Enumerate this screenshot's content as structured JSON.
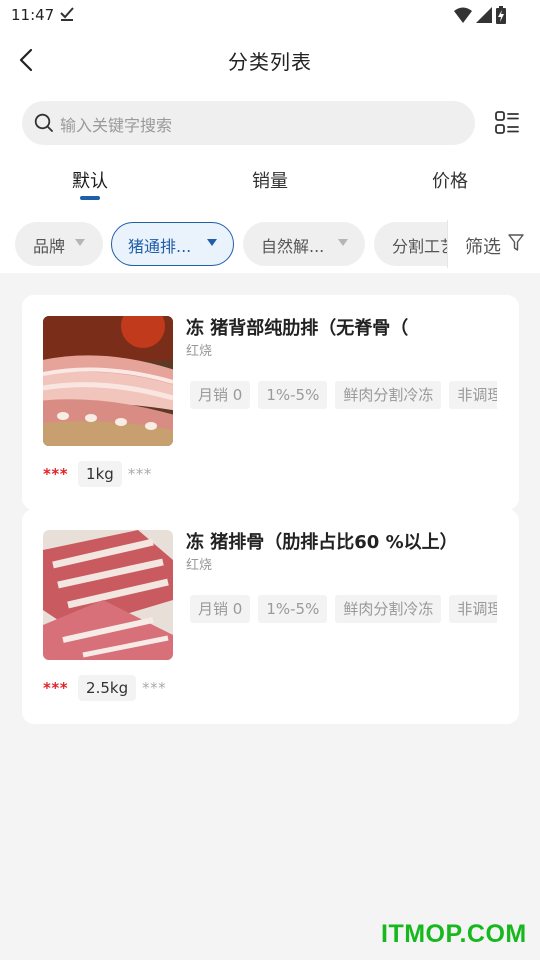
{
  "status_bar": {
    "time": "11:47",
    "icons": [
      "download-done-icon",
      "wifi-icon",
      "signal-icon",
      "battery-charging-icon"
    ]
  },
  "header": {
    "title": "分类列表",
    "back_icon": "chevron-left-icon"
  },
  "search": {
    "placeholder": "输入关键字搜索",
    "icon": "search-icon",
    "layout_toggle_icon": "list-grid-icon"
  },
  "sort_tabs": [
    {
      "label": "默认",
      "active": true
    },
    {
      "label": "销量",
      "active": false
    },
    {
      "label": "价格",
      "active": false
    }
  ],
  "filter_chips": [
    {
      "label": "品牌",
      "selected": false
    },
    {
      "label": "猪通排...",
      "selected": true
    },
    {
      "label": "自然解...",
      "selected": false
    },
    {
      "label": "分割工艺",
      "selected": false
    }
  ],
  "filter_button": {
    "label": "筛选",
    "icon": "funnel-icon"
  },
  "products": [
    {
      "name": "冻 猪背部纯肋排（无脊骨（",
      "sub": "红烧",
      "tags": [
        "月销 0",
        "1%-5%",
        "鲜肉分割冷冻",
        "非调理"
      ],
      "price_masked": "***",
      "unit": "1kg",
      "unit_price_masked": "***",
      "image": "pork-ribs-photo"
    },
    {
      "name": "冻 猪排骨（肋排占比60 %以上）",
      "sub": "红烧",
      "tags": [
        "月销 0",
        "1%-5%",
        "鲜肉分割冷冻",
        "非调理"
      ],
      "price_masked": "***",
      "unit": "2.5kg",
      "unit_price_masked": "***",
      "image": "pork-spareribs-photo"
    }
  ],
  "watermark": "ITMOP.COM",
  "colors": {
    "accent": "#1f5ea8",
    "price_red": "#e0242a",
    "background": "#f4f4f4",
    "watermark_green": "#16b81e"
  }
}
